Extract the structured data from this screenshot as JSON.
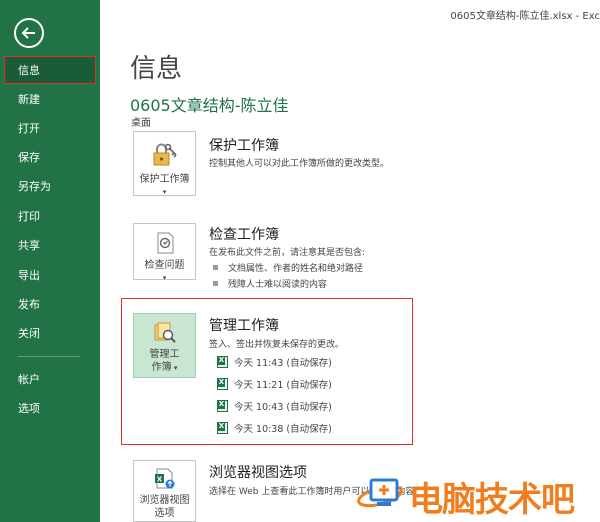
{
  "window": {
    "title": "0605文章结构-陈立佳.xlsx - Exc"
  },
  "sidebar": {
    "items": [
      {
        "label": "信息"
      },
      {
        "label": "新建"
      },
      {
        "label": "打开"
      },
      {
        "label": "保存"
      },
      {
        "label": "另存为"
      },
      {
        "label": "打印"
      },
      {
        "label": "共享"
      },
      {
        "label": "导出"
      },
      {
        "label": "发布"
      },
      {
        "label": "关闭"
      },
      {
        "label": "帐户"
      },
      {
        "label": "选项"
      }
    ]
  },
  "main": {
    "page_title": "信息",
    "doc_title": "0605文章结构-陈立佳",
    "doc_path": "桌面",
    "protect": {
      "button_label_1": "保护工作簿",
      "title": "保护工作簿",
      "desc": "控制其他人可以对此工作簿所做的更改类型。"
    },
    "inspect": {
      "button_label_1": "检查问题",
      "title": "检查工作簿",
      "desc": "在发布此文件之前，请注意其是否包含:",
      "bullets": [
        "文档属性、作者的姓名和绝对路径",
        "残障人士难以阅读的内容"
      ]
    },
    "manage": {
      "button_label_1": "管理工",
      "button_label_2": "作簿",
      "title": "管理工作簿",
      "desc": "签入、签出并恢复未保存的更改。",
      "versions": [
        "今天 11:43 (自动保存)",
        "今天 11:21 (自动保存)",
        "今天 10:43 (自动保存)",
        "今天 10:38 (自动保存)"
      ]
    },
    "browser": {
      "button_label_1": "浏览器视图",
      "button_label_2": "选项",
      "title": "浏览器视图选项",
      "desc": "选择在 Web 上查看此工作簿时用户可以看到的内容"
    }
  },
  "watermark": {
    "text": "电脑技术吧"
  },
  "colors": {
    "accent": "#217346",
    "highlight_border": "#e0302b",
    "watermark": "#f07d1e"
  }
}
